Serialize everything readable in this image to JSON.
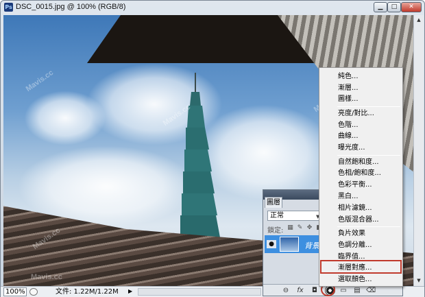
{
  "window": {
    "app_icon_text": "Ps",
    "title": "DSC_0015.jpg @ 100% (RGB/8)",
    "minimize_label": "▁",
    "maximize_label": "□",
    "close_label": "✕"
  },
  "watermark": "Mavis.cc",
  "status_bar": {
    "zoom": "100%",
    "doc_info": "文件: 1.22M/1.22M",
    "arrow": "▶"
  },
  "layers_panel": {
    "tab_label": "圖層",
    "blend_mode": "正常",
    "lock_label": "鎖定:",
    "layer_name": "背景",
    "eye_glyph": "●",
    "footer_icons": [
      "⊖",
      "fx",
      "◘",
      "▭",
      "▤",
      "⌫"
    ]
  },
  "adjustment_menu": {
    "groups": [
      [
        "純色...",
        "漸層...",
        "圖樣..."
      ],
      [
        "亮度/對比...",
        "色階...",
        "曲線...",
        "曝光度..."
      ],
      [
        "自然飽和度...",
        "色相/飽和度...",
        "色彩平衡...",
        "黑白...",
        "相片濾鏡...",
        "色版混合器..."
      ],
      [
        "負片效果",
        "色調分離...",
        "臨界值...",
        "漸層對應...",
        "選取顏色..."
      ]
    ],
    "highlighted_item": "漸層對應..."
  },
  "colors": {
    "highlight_red": "#c0392b",
    "layer_selected": "#3d8fe0"
  }
}
